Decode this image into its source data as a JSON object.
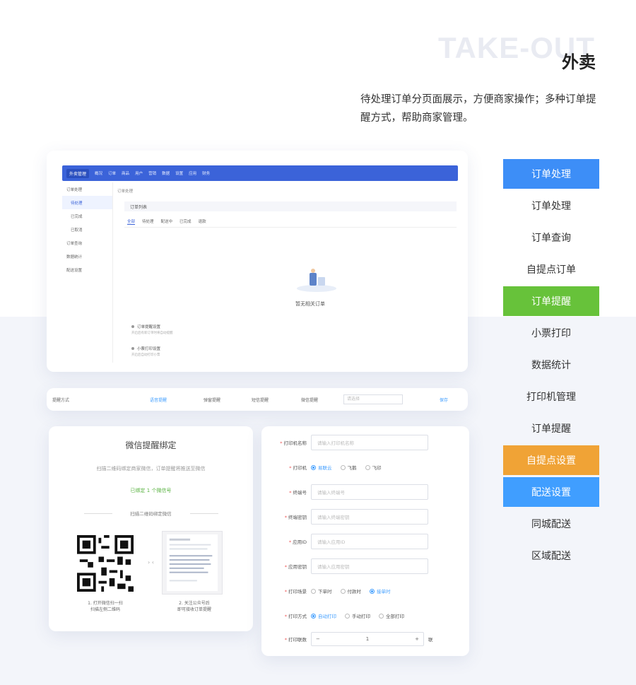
{
  "header": {
    "bg_word": "TAKE-OUT",
    "title": "外卖",
    "description": "待处理订单分页面展示，方便商家操作；多种订单提醒方式，帮助商家管理。"
  },
  "features": [
    {
      "label": "订单处理",
      "style": "blue"
    },
    {
      "label": "订单处理",
      "style": "plain"
    },
    {
      "label": "订单查询",
      "style": "plain"
    },
    {
      "label": "自提点订单",
      "style": "plain"
    },
    {
      "label": "订单提醒",
      "style": "green"
    },
    {
      "label": "小票打印",
      "style": "plain"
    },
    {
      "label": "数据统计",
      "style": "plain"
    },
    {
      "label": "打印机管理",
      "style": "plain"
    },
    {
      "label": "订单提醒",
      "style": "plain"
    },
    {
      "label": "自提点设置",
      "style": "orange"
    },
    {
      "label": "配送设置",
      "style": "blue2"
    },
    {
      "label": "同城配送",
      "style": "plain"
    },
    {
      "label": "区域配送",
      "style": "plain"
    }
  ],
  "screenshot": {
    "logo": "外卖管理",
    "nav": [
      "概况",
      "订单",
      "商品",
      "用户",
      "营销",
      "数据",
      "设置",
      "应用",
      "财务"
    ],
    "sidebar": [
      "订单处理",
      "待处理",
      "已完成",
      "已取消",
      "订单查询",
      "数据统计",
      "配送设置"
    ],
    "breadcrumb": "订单处理",
    "order_bar": "订单列表",
    "tabs": [
      "全部",
      "待处理",
      "配送中",
      "已完成",
      "退款"
    ],
    "empty_text": "暂无相关订单",
    "notices": [
      {
        "title": "订单提醒设置",
        "sub": "开启后有新订单时将自动提醒"
      },
      {
        "title": "小票打印设置",
        "sub": "开启后自动打印小票"
      }
    ]
  },
  "strip": {
    "label": "提醒方式",
    "items": [
      "语音提醒",
      "弹窗提醒",
      "短信提醒",
      "微信提醒"
    ],
    "input_placeholder": "请选择",
    "right": "保存"
  },
  "scan_card": {
    "title": "微信提醒绑定",
    "subtitle": "扫描二维码绑定商家微信，订单提醒将推送至微信",
    "status": "已绑定 1 个微信号",
    "divider": "扫描二维码绑定微信",
    "caption_left": "1. 打开微信扫一扫\n扫描左侧二维码",
    "caption_right": "2. 关注公众号后\n即可接收订单提醒"
  },
  "form": {
    "rows": [
      {
        "label": "打印机名称",
        "placeholder": "请输入打印机名称"
      },
      {
        "label": "打印机",
        "options": [
          "易联云",
          "飞鹅",
          "飞印"
        ],
        "selected": 0
      },
      {
        "label": "终端号",
        "placeholder": "请输入终端号"
      },
      {
        "label": "终端密钥",
        "placeholder": "请输入终端密钥"
      },
      {
        "label": "应用ID",
        "placeholder": "请输入应用ID"
      },
      {
        "label": "应用密钥",
        "placeholder": "请输入应用密钥"
      },
      {
        "label": "打印场景",
        "options": [
          "下单时",
          "付款时",
          "接单时"
        ],
        "selected": 2
      },
      {
        "label": "打印方式",
        "options": [
          "自动打印",
          "手动打印",
          "全部打印"
        ],
        "selected": 0
      }
    ],
    "copies_label": "打印联数",
    "copies_value": "1",
    "copies_unit": "联"
  }
}
